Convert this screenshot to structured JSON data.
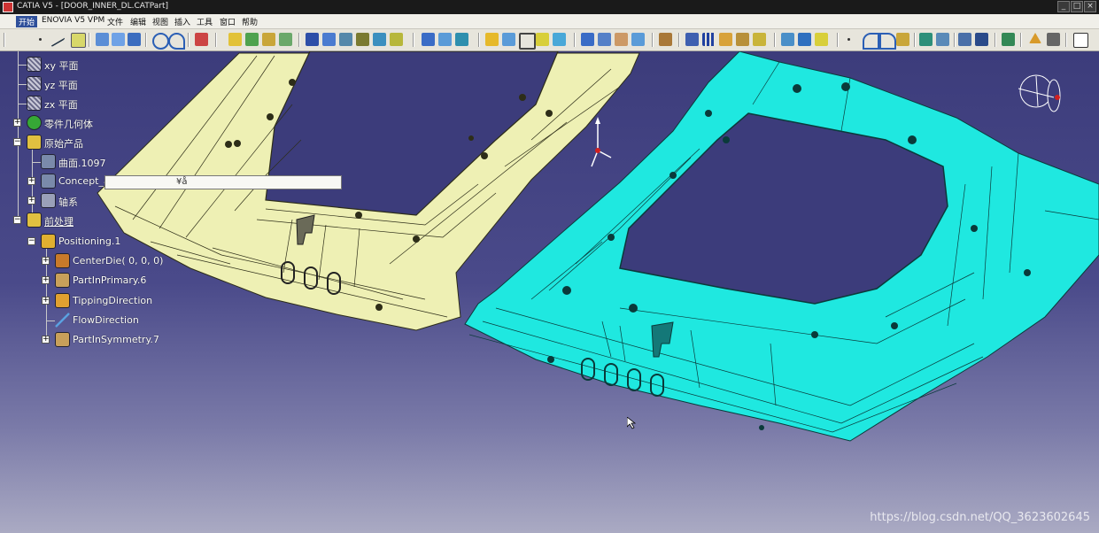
{
  "window": {
    "title": "CATIA V5 - [DOOR_INNER_DL.CATPart]",
    "controls": {
      "minimize": "_",
      "maximize": "□",
      "close": "×"
    }
  },
  "menubar": {
    "items": [
      "开始",
      "ENOVIA V5 VPM",
      "文件",
      "编辑",
      "视图",
      "插入",
      "工具",
      "窗口",
      "帮助"
    ]
  },
  "colors": {
    "viewport_top": "#3c3c7b",
    "viewport_bottom": "#aaaac3",
    "part_original": "#eef0b4",
    "part_positioned": "#1fe8e0",
    "tree_text": "#ffffff"
  },
  "tree": {
    "items": [
      {
        "label": "xy 平面",
        "icon": "plane-icon"
      },
      {
        "label": "yz 平面",
        "icon": "plane-icon"
      },
      {
        "label": "zx 平面",
        "icon": "plane-icon"
      },
      {
        "label": "零件几何体",
        "icon": "part-body-icon"
      },
      {
        "label": "原始产品",
        "icon": "product-icon"
      },
      {
        "label": "曲面.1097",
        "icon": "surface-icon"
      },
      {
        "label": "Concept_æ±½æ¯¡ç½ -DOOR_INNER_CP-â°§å -8å",
        "icon": "concept-icon"
      },
      {
        "label": "轴系",
        "icon": "axis-system-icon"
      },
      {
        "label": "前处理",
        "icon": "preprocess-icon"
      },
      {
        "label": "Positioning.1",
        "icon": "positioning-icon"
      },
      {
        "label": "CenterDie(  0,   0,   0)",
        "icon": "center-die-icon"
      },
      {
        "label": "PartInPrimary.6",
        "icon": "part-in-primary-icon"
      },
      {
        "label": "TippingDirection",
        "icon": "tipping-direction-icon"
      },
      {
        "label": "FlowDirection",
        "icon": "flow-direction-icon"
      },
      {
        "label": "PartInSymmetry.7",
        "icon": "part-in-symmetry-icon"
      }
    ],
    "tooltip": "¥å"
  },
  "watermark": "https://blog.csdn.net/QQ_3623602645"
}
